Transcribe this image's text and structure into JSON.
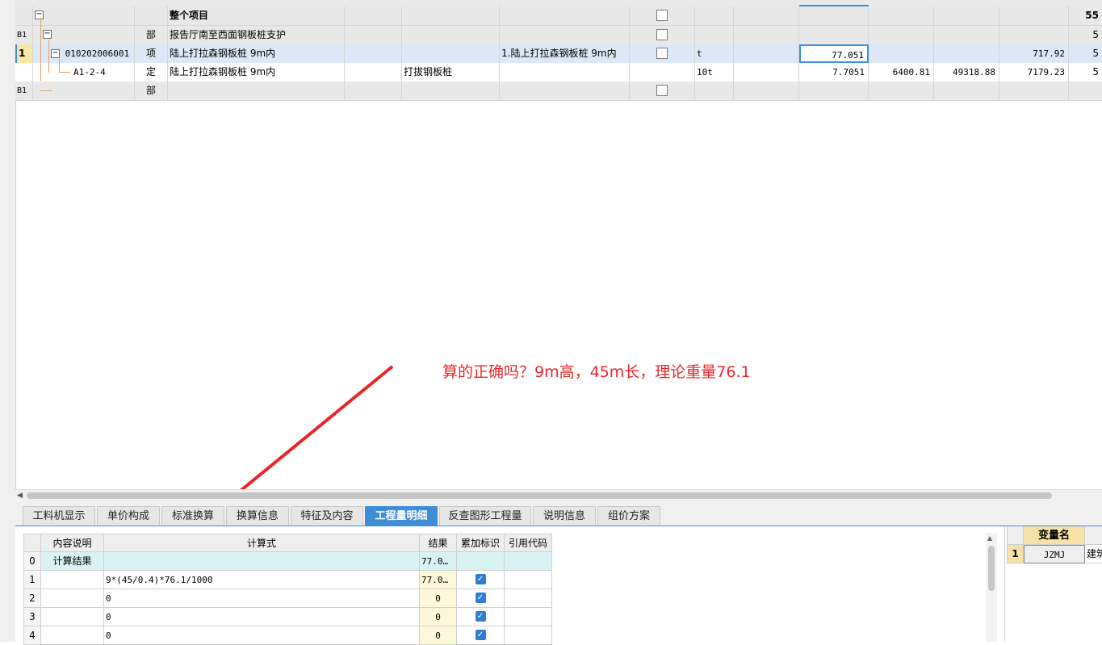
{
  "main_grid": {
    "rows": [
      {
        "num": "",
        "code": "",
        "type": "",
        "name": "整个项目",
        "content": "",
        "feature": "",
        "unit": "",
        "qty": "",
        "price": "",
        "total": "",
        "unit_total": "",
        "last": "55"
      },
      {
        "num": "B1",
        "code": "",
        "type": "部",
        "name": "报告厅南至西面钢板桩支护",
        "content": "",
        "feature": "",
        "unit": "",
        "qty": "",
        "price": "",
        "total": "",
        "unit_total": "",
        "last": "5"
      },
      {
        "num": "1",
        "code": "010202006001",
        "type": "项",
        "name": "陆上打拉森钢板桩 9m内",
        "content": "",
        "feature": "1.陆上打拉森钢板桩 9m内",
        "unit": "t",
        "qty": "77.051",
        "price": "",
        "total": "",
        "unit_total": "717.92",
        "last": "5"
      },
      {
        "num": "",
        "code": "A1-2-4",
        "type": "定",
        "name": "陆上打拉森钢板桩 9m内",
        "content": "打拔钢板桩",
        "feature": "",
        "unit": "10t",
        "qty": "7.7051",
        "price": "6400.81",
        "total": "49318.88",
        "unit_total": "7179.23",
        "last": "5"
      },
      {
        "num": "B1",
        "code": "",
        "type": "部",
        "name": "",
        "content": "",
        "feature": "",
        "unit": "",
        "qty": "",
        "price": "",
        "total": "",
        "unit_total": "",
        "last": ""
      }
    ]
  },
  "annotation": "算的正确吗？9m高，45m长，理论重量76.1",
  "annotation_color": "#e8262a",
  "tabs": [
    {
      "label": "工料机显示"
    },
    {
      "label": "单价构成"
    },
    {
      "label": "标准换算"
    },
    {
      "label": "换算信息"
    },
    {
      "label": "特征及内容"
    },
    {
      "label": "工程量明细"
    },
    {
      "label": "反查图形工程量"
    },
    {
      "label": "说明信息"
    },
    {
      "label": "组价方案"
    }
  ],
  "active_tab": "工程量明细",
  "detail_grid": {
    "headers": {
      "desc": "内容说明",
      "formula": "计算式",
      "result": "结果",
      "accumulate": "累加标识",
      "ref": "引用代码"
    },
    "rows": [
      {
        "num": "0",
        "desc": "计算结果",
        "formula": "",
        "result": "77.0…",
        "checked": false
      },
      {
        "num": "1",
        "desc": "",
        "formula": "9*(45/0.4)*76.1/1000",
        "result": "77.0…",
        "checked": true
      },
      {
        "num": "2",
        "desc": "",
        "formula": "0",
        "result": "0",
        "checked": true
      },
      {
        "num": "3",
        "desc": "",
        "formula": "0",
        "result": "0",
        "checked": true
      },
      {
        "num": "4",
        "desc": "",
        "formula": "0",
        "result": "0",
        "checked": true
      }
    ]
  },
  "variable_panel": {
    "header": "变量名",
    "rows": [
      {
        "num": "1",
        "name": "JZMJ",
        "extra": "建筑"
      }
    ]
  },
  "icons": {
    "collapse": "minus-box-icon",
    "check": "checkbox-icon",
    "scroll_left": "triangle-left-icon"
  }
}
